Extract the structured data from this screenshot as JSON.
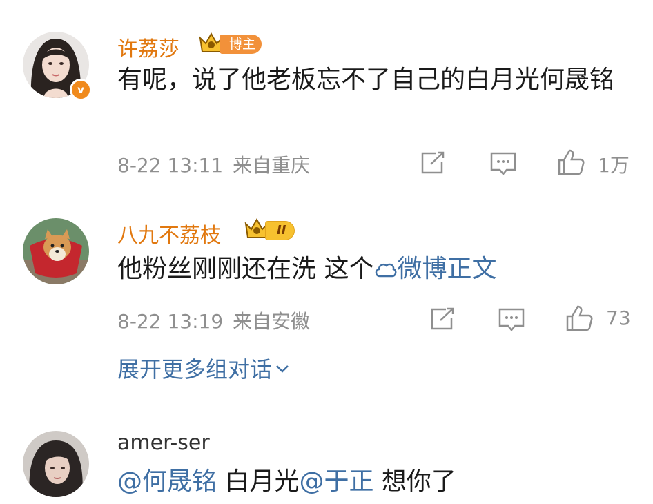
{
  "comments": [
    {
      "username": "许荔莎",
      "role_badge": "博主",
      "text": "有呢，说了他老板忘不了自己的白月光何晟铭",
      "date": "8-22 13:11",
      "location": "来自重庆",
      "likes": "1万"
    },
    {
      "username": "八九不荔枝",
      "level_badge": "II",
      "text": "他粉丝刚刚还在洗  这个",
      "link_text": "微博正文",
      "date": "8-22 13:19",
      "location": "来自安徽",
      "likes": "73"
    },
    {
      "username": "amer-ser",
      "mention1": "@何晟铭",
      "text_mid": " 白月光",
      "mention2": "@于正",
      "text_end": " 想你了"
    }
  ],
  "expand_label": "展开更多组对话",
  "verified_mark": "v",
  "colors": {
    "username": "#e1780f",
    "link": "#3f6fa4",
    "meta": "#8f8f8f",
    "badge": "#f2913a"
  }
}
